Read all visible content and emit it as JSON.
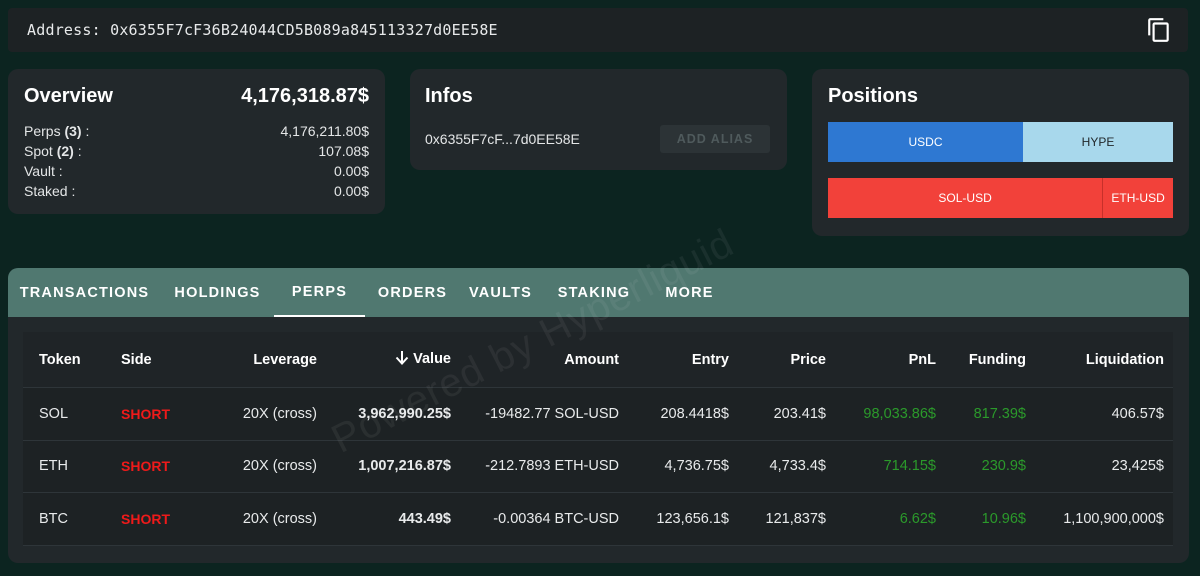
{
  "address_bar": {
    "label": "Address:",
    "value": "0x6355F7cF36B24044CD5B089a845113327d0EE58E",
    "copy_icon": "copy-icon"
  },
  "overview": {
    "title": "Overview",
    "total": "4,176,318.87$",
    "rows": [
      {
        "label": "Perps",
        "count": "(3)",
        "suffix": " :",
        "value": "4,176,211.80$"
      },
      {
        "label": "Spot",
        "count": "(2)",
        "suffix": " :",
        "value": "107.08$"
      },
      {
        "label": "Vault",
        "count": "",
        "suffix": " :",
        "value": "0.00$"
      },
      {
        "label": "Staked",
        "count": "",
        "suffix": " :",
        "value": "0.00$"
      }
    ]
  },
  "infos": {
    "title": "Infos",
    "short_address": "0x6355F7cF...7d0EE58E",
    "alias_button": "ADD ALIAS"
  },
  "positions": {
    "title": "Positions",
    "bar1": [
      {
        "label": "USDC",
        "color": "#2e78d2"
      },
      {
        "label": "HYPE",
        "color": "#a8d8ec"
      }
    ],
    "bar2": [
      {
        "label": "SOL-USD",
        "color": "#f2413a"
      },
      {
        "label": "ETH-USD",
        "color": "#f2413a"
      }
    ]
  },
  "tabs": [
    {
      "label": "TRANSACTIONS"
    },
    {
      "label": "HOLDINGS"
    },
    {
      "label": "PERPS",
      "active": true
    },
    {
      "label": "ORDERS"
    },
    {
      "label": "VAULTS"
    },
    {
      "label": "STAKING"
    },
    {
      "label": "MORE"
    }
  ],
  "table": {
    "headers": [
      "Token",
      "Side",
      "Leverage",
      "Value",
      "Amount",
      "Entry",
      "Price",
      "PnL",
      "Funding",
      "Liquidation"
    ],
    "sort_icon": "arrow-down-icon",
    "rows": [
      {
        "token": "SOL",
        "side": "SHORT",
        "leverage": "20X (cross)",
        "value": "3,962,990.25$",
        "amount": "-19482.77 SOL-USD",
        "entry": "208.4418$",
        "price": "203.41$",
        "pnl": "98,033.86$",
        "funding": "817.39$",
        "liquidation": "406.57$"
      },
      {
        "token": "ETH",
        "side": "SHORT",
        "leverage": "20X (cross)",
        "value": "1,007,216.87$",
        "amount": "-212.7893 ETH-USD",
        "entry": "4,736.75$",
        "price": "4,733.4$",
        "pnl": "714.15$",
        "funding": "230.9$",
        "liquidation": "23,425$"
      },
      {
        "token": "BTC",
        "side": "SHORT",
        "leverage": "20X (cross)",
        "value": "443.49$",
        "amount": "-0.00364 BTC-USD",
        "entry": "123,656.1$",
        "price": "121,837$",
        "pnl": "6.62$",
        "funding": "10.96$",
        "liquidation": "1,100,900,000$"
      }
    ]
  },
  "watermark": "Powered by Hyperliquid",
  "colors": {
    "background": "#0c2420",
    "card": "#22282b",
    "tab_bar": "#507870",
    "short": "#ef1a1a",
    "positive": "#2b9a2b"
  }
}
